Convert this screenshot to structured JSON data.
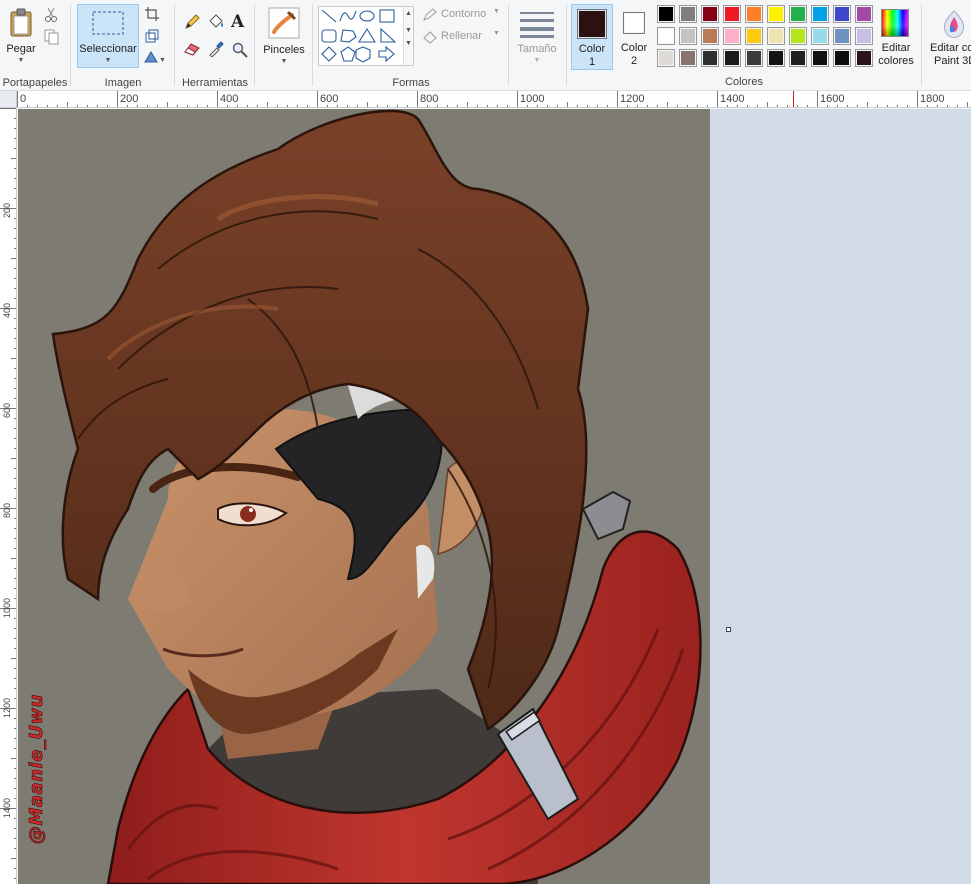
{
  "ribbon": {
    "clipboard": {
      "group_label": "Portapapeles",
      "paste_label": "Pegar"
    },
    "image": {
      "group_label": "Imagen",
      "select_label": "Seleccionar"
    },
    "tools": {
      "group_label": "Herramientas"
    },
    "brushes": {
      "label": "Pinceles"
    },
    "shapes": {
      "group_label": "Formas",
      "outline_label": "Contorno",
      "fill_label": "Rellenar"
    },
    "size": {
      "label": "Tamaño"
    },
    "colors": {
      "group_label": "Colores",
      "color1_label": "Color",
      "color1_num": "1",
      "color2_label": "Color",
      "color2_num": "2",
      "color1": "#2b1110",
      "color2": "#ffffff",
      "edit_label_1": "Editar",
      "edit_label_2": "colores",
      "palette": [
        [
          "#000000",
          "#7f7f7f",
          "#880015",
          "#ed1c24",
          "#ff7f27",
          "#fff200",
          "#22b14c",
          "#00a2e8",
          "#3f48cc",
          "#a349a4"
        ],
        [
          "#ffffff",
          "#c3c3c3",
          "#b97a57",
          "#ffaec9",
          "#ffc90e",
          "#efe4b0",
          "#b5e61d",
          "#99d9ea",
          "#7092be",
          "#c8bfe7"
        ],
        [
          "#dedbd6",
          "#85756e",
          "#2f2f2f",
          "#1c1c1c",
          "#3b3b3b",
          "#141414",
          "#202020",
          "#111111",
          "#0d0d0d",
          "#2a1619"
        ]
      ]
    },
    "paint3d": {
      "label_1": "Editar co",
      "label_2": "Paint 3D"
    }
  },
  "ruler": {
    "h_labels": [
      "0",
      "200",
      "400",
      "600",
      "800",
      "1000",
      "1200",
      "1400",
      "1600",
      "1800"
    ],
    "v_labels": [
      "200",
      "400",
      "600",
      "800",
      "1000",
      "1200",
      "1400"
    ]
  },
  "canvas": {
    "background": "#7e7b72",
    "watermark": "@Maanie_Uwu"
  }
}
